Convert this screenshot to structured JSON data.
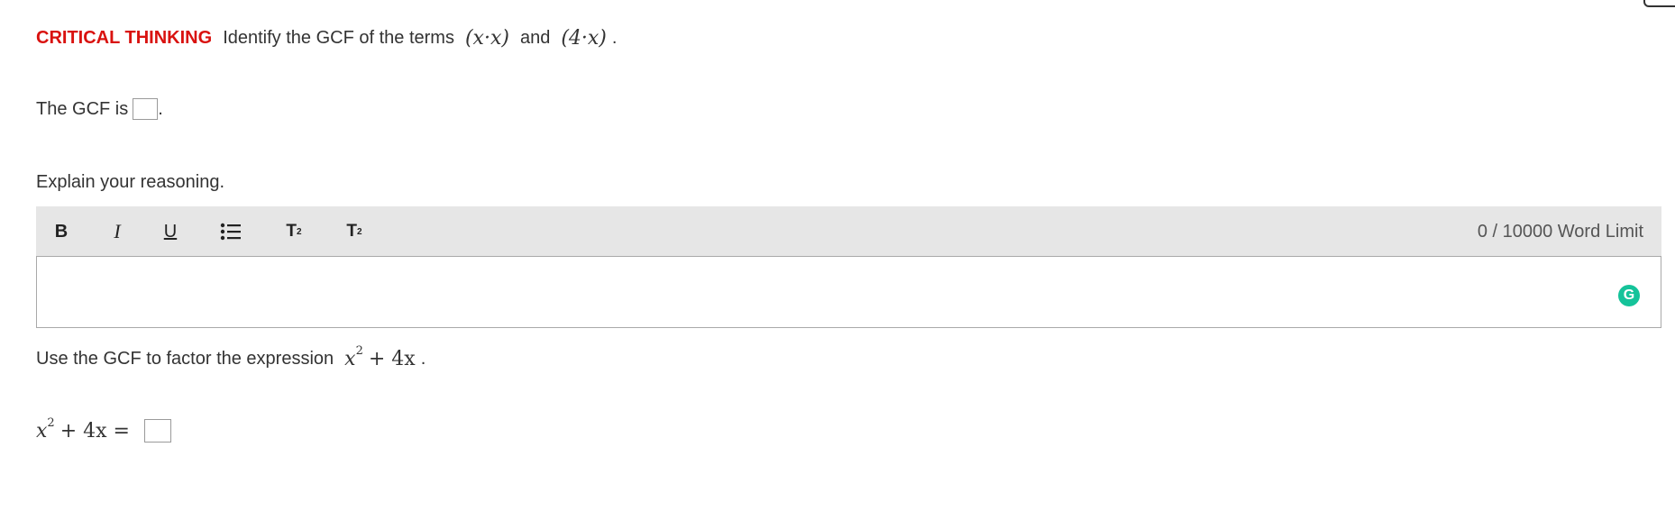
{
  "question1": {
    "tag": "CRITICAL THINKING",
    "prompt": "Identify the GCF of the terms",
    "term1": "(x·x)",
    "connector": "and",
    "term2": "(4·x)",
    "end_punct": "."
  },
  "gcf_line": {
    "label": "The GCF is",
    "end_punct": ".",
    "answer_value": ""
  },
  "explain": {
    "prompt": "Explain your reasoning.",
    "word_limit": "0 / 10000 Word Limit",
    "toolbar": {
      "bold": "B",
      "italic": "I",
      "underline": "U",
      "list_icon": "bulleted-list-icon",
      "superscript_base": "T",
      "superscript_mark": "2",
      "subscript_base": "T",
      "subscript_mark": "2"
    },
    "content": "",
    "grammarly_icon": "grammarly-icon",
    "grammarly_letter": "G",
    "grammarly_color": "#15c39a"
  },
  "question2": {
    "prompt": "Use the GCF to factor the expression",
    "expression_base": "x",
    "expression_exp": "2",
    "expression_rest": "+ 4x",
    "end_punct": "."
  },
  "equation": {
    "lhs_base": "x",
    "lhs_exp": "2",
    "lhs_rest": "+ 4x =",
    "answer_value": ""
  },
  "colors": {
    "critical_thinking": "#d9120f",
    "toolbar_bg": "#e6e6e6",
    "text": "#333333"
  }
}
